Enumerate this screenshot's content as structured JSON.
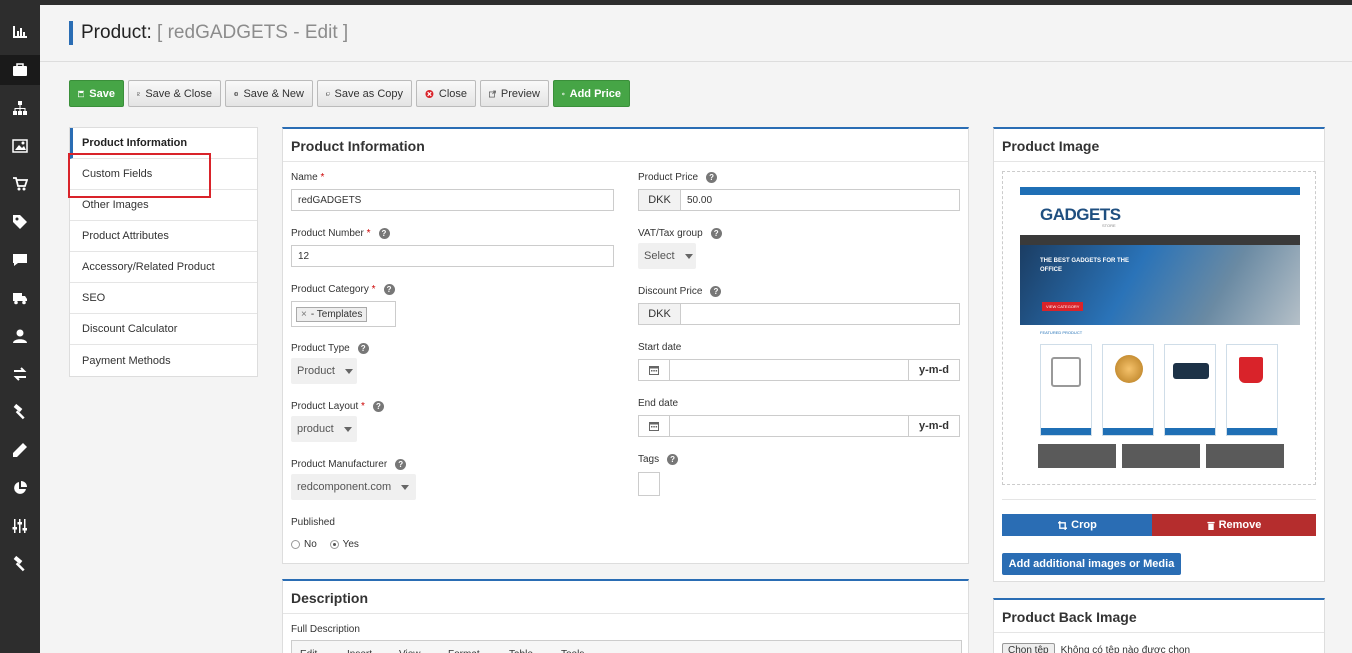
{
  "header": {
    "title": "Product:",
    "subtitle": "[ redGADGETS - Edit ]"
  },
  "toolbar": {
    "save": "Save",
    "save_close": "Save & Close",
    "save_new": "Save & New",
    "save_copy": "Save as Copy",
    "close": "Close",
    "preview": "Preview",
    "add_price": "Add Price"
  },
  "tabs": [
    "Product Information",
    "Custom Fields",
    "Other Images",
    "Product Attributes",
    "Accessory/Related Product",
    "SEO",
    "Discount Calculator",
    "Payment Methods"
  ],
  "info": {
    "title": "Product Information",
    "name_label": "Name",
    "name_value": "redGADGETS",
    "number_label": "Product Number",
    "number_value": "12",
    "category_label": "Product Category",
    "category_tag": "- Templates",
    "type_label": "Product Type",
    "type_value": "Product",
    "layout_label": "Product Layout",
    "layout_value": "product",
    "manufacturer_label": "Product Manufacturer",
    "manufacturer_value": "redcomponent.com",
    "published_label": "Published",
    "published_no": "No",
    "published_yes": "Yes",
    "price_label": "Product Price",
    "currency": "DKK",
    "price_value": "50.00",
    "vat_label": "VAT/Tax group",
    "vat_value": "Select",
    "discount_label": "Discount Price",
    "start_label": "Start date",
    "end_label": "End date",
    "date_format": "y-m-d",
    "tags_label": "Tags",
    "required_mark": "*",
    "help_mark": "?"
  },
  "description": {
    "title": "Description",
    "full_label": "Full Description",
    "menu": [
      "Edit",
      "Insert",
      "View",
      "Format",
      "Table",
      "Tools"
    ]
  },
  "image_panel": {
    "title": "Product Image",
    "crop": "Crop",
    "remove": "Remove",
    "add_media": "Add additional images or Media",
    "mock_logo": "GADGETS",
    "mock_logo_sub": "STORE",
    "mock_banner": "THE BEST GADGETS FOR THE OFFICE",
    "mock_view": "VIEW CATEGORY",
    "mock_featured": "FEATURED PRODUCT"
  },
  "back_image": {
    "title": "Product Back Image",
    "choose": "Chọn tệp",
    "no_file": "Không có tệp nào được chọn"
  },
  "colors": {
    "accent": "#2a6db4",
    "green": "#46a546",
    "red": "#b52d2d",
    "blue": "#2a6db4",
    "highlight": "#d9232a",
    "sidebar": "#2d2d2d"
  }
}
